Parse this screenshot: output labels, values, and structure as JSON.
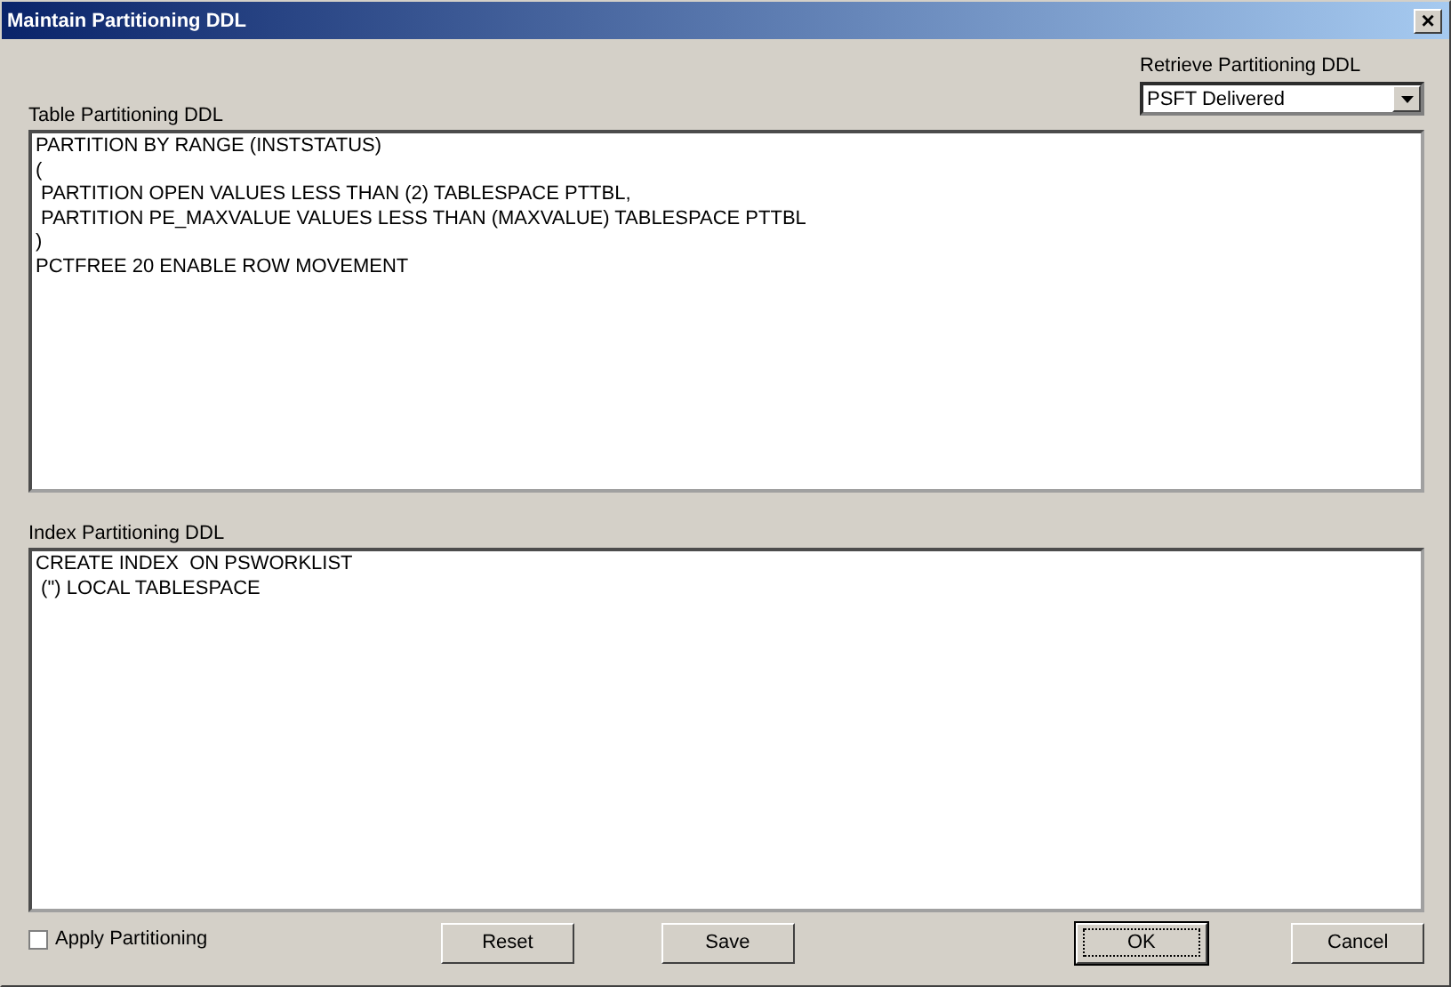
{
  "window": {
    "title": "Maintain Partitioning DDL",
    "close": "×"
  },
  "retrieve": {
    "label": "Retrieve Partitioning DDL",
    "value": "PSFT Delivered"
  },
  "table_ddl": {
    "label": "Table Partitioning DDL",
    "lines": [
      "PARTITION BY RANGE (INSTSTATUS)",
      "(",
      " PARTITION OPEN VALUES LESS THAN (2) TABLESPACE PTTBL,",
      " PARTITION PE_MAXVALUE VALUES LESS THAN (MAXVALUE) TABLESPACE PTTBL",
      ")",
      "PCTFREE 20 ENABLE ROW MOVEMENT"
    ]
  },
  "index_ddl": {
    "label": "Index Partitioning DDL",
    "lines": [
      "CREATE INDEX  ON PSWORKLIST",
      " (\") LOCAL TABLESPACE"
    ]
  },
  "apply_partitioning": {
    "label": "Apply Partitioning",
    "checked": false
  },
  "buttons": [
    {
      "label": "Reset",
      "default": false
    },
    {
      "label": "Save",
      "default": false
    },
    {
      "label": "OK",
      "default": true
    },
    {
      "label": "Cancel",
      "default": false
    }
  ]
}
